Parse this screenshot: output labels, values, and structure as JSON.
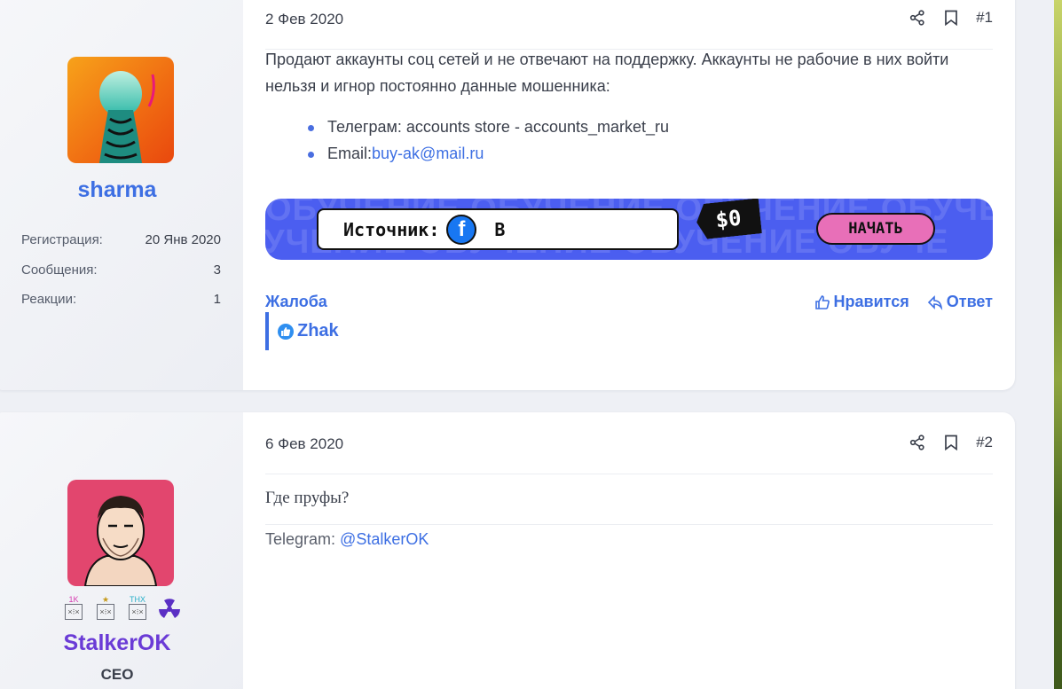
{
  "posts": [
    {
      "user": {
        "name": "sharma",
        "name_color": "#3d6fe3",
        "stats": [
          {
            "label": "Регистрация:",
            "value": "20 Янв 2020"
          },
          {
            "label": "Сообщения:",
            "value": "3"
          },
          {
            "label": "Реакции:",
            "value": "1"
          }
        ]
      },
      "date": "2 Фев 2020",
      "number": "#1",
      "message": "Продают аккаунты соц сетей и не отвечают на поддержку. Аккаунты не рабочие в них войти нельзя и игнор постоянно данные мошенника:",
      "bullets": [
        {
          "text": "Телеграм: accounts store - accounts_market_ru"
        },
        {
          "prefix": "Email:",
          "link": "buy-ak@mail.ru"
        }
      ],
      "banner": {
        "bg_text": "ОБУЧЕНИЕ ОБУЧЕНИЕ ОБУЧЕНИЕ ОБУЧЕ",
        "source_label": "Источник:",
        "fb_letter": "f",
        "tail": "В",
        "price": "$0",
        "start_label": "НАЧАТЬ"
      },
      "footer": {
        "report": "Жалоба",
        "like": "Нравится",
        "reply": "Ответ"
      },
      "reactions": {
        "users": "Zhak"
      }
    },
    {
      "user": {
        "name": "StalkerOK",
        "name_color": "#6a3bd6",
        "role": "CEO",
        "badges": [
          {
            "top": "1K",
            "top_color": "#d63bb0"
          },
          {
            "top": "★",
            "top_color": "#c69a1a"
          },
          {
            "top": "THX",
            "top_color": "#2ab0c9"
          },
          {
            "top": "",
            "icon": "radiation-icon"
          }
        ]
      },
      "date": "6 Фев 2020",
      "number": "#2",
      "message": "Где пруфы?",
      "signature": {
        "prefix": "Telegram: ",
        "link": "@StalkerOK"
      }
    }
  ],
  "colors": {
    "accent": "#3d6fe3",
    "banner": "#4b5ef0",
    "start_button": "#e86fb8"
  }
}
